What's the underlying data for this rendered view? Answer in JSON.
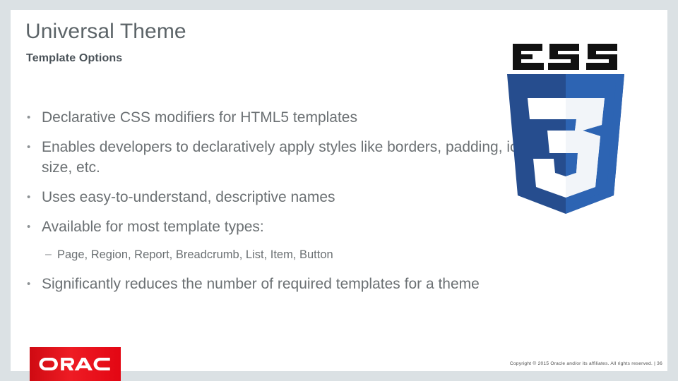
{
  "slide": {
    "title": "Universal Theme",
    "subtitle": "Template Options",
    "background_color": "#ffffff",
    "frame_color": "#dbe1e4"
  },
  "bullets": [
    {
      "level": 1,
      "marker": "•",
      "text": "Declarative CSS modifiers for HTML5 templates"
    },
    {
      "level": 1,
      "marker": "•",
      "text": "Enables developers to declaratively apply styles like borders,  padding, icons, colors, size, etc."
    },
    {
      "level": 1,
      "marker": "•",
      "text": "Uses easy-to-understand, descriptive names"
    },
    {
      "level": 1,
      "marker": "•",
      "text": "Available for most template types:"
    },
    {
      "level": 2,
      "marker": "–",
      "text": "Page, Region, Report, Breadcrumb, List, Item, Button"
    },
    {
      "level": 1,
      "marker": "•",
      "text": "Significantly reduces the number of required templates for a theme"
    }
  ],
  "logo": {
    "name": "css3-logo",
    "wordmark": "CSS",
    "numeral": "3",
    "shield_outer_color": "#264D8E",
    "shield_inner_color": "#2D64B3",
    "wordmark_color": "#111111",
    "numeral_color": "#ffffff"
  },
  "footer": {
    "brand": "ORACLE",
    "brand_color": "#e8111a",
    "copyright": "Copyright © 2015 Oracle and/or its affiliates. All rights reserved.  |  36"
  }
}
